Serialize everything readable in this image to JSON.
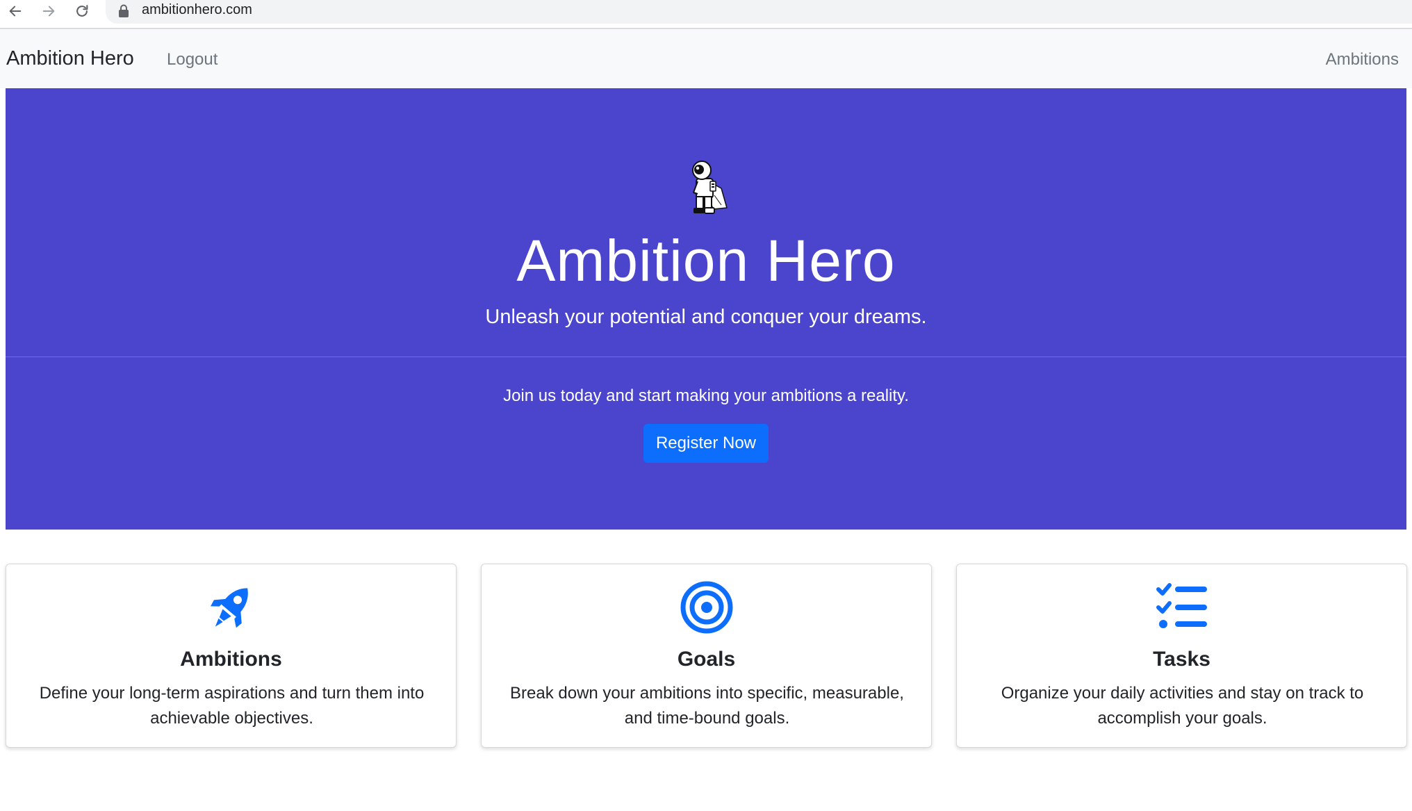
{
  "browser": {
    "url": "ambitionhero.com"
  },
  "navbar": {
    "brand": "Ambition Hero",
    "logout_label": "Logout",
    "ambitions_label": "Ambitions"
  },
  "hero": {
    "title": "Ambition Hero",
    "lead": "Unleash your potential and conquer your dreams.",
    "subtext": "Join us today and start making your ambitions a reality.",
    "register_label": "Register Now",
    "figure": "astronaut-icon"
  },
  "features": [
    {
      "icon": "rocket-icon",
      "title": "Ambitions",
      "text": "Define your long-term aspirations and turn them into achievable objectives."
    },
    {
      "icon": "target-icon",
      "title": "Goals",
      "text": "Break down your ambitions into specific, measurable, and time-bound goals."
    },
    {
      "icon": "checklist-icon",
      "title": "Tasks",
      "text": "Organize your daily activities and stay on track to accomplish your goals."
    }
  ],
  "colors": {
    "hero_background": "#4a45cc",
    "primary": "#0d6efd",
    "navbar_background": "#f8f9fa",
    "nav_link": "#6c757d"
  }
}
